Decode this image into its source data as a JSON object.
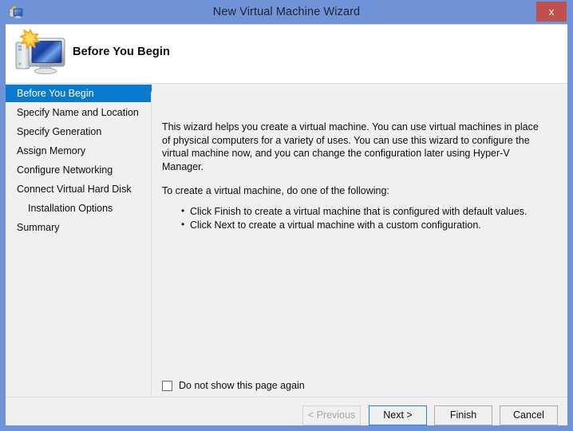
{
  "window": {
    "title": "New Virtual Machine Wizard",
    "title_icon": "virtual-machine-icon",
    "close_label": "x",
    "frame_color": "#6f93d6",
    "close_color": "#c0504d"
  },
  "banner": {
    "heading": "Before You Begin",
    "icon": "monitor-with-star-icon"
  },
  "sidebar": {
    "items": [
      {
        "label": "Before You Begin",
        "selected": true,
        "indent": false
      },
      {
        "label": "Specify Name and Location",
        "selected": false,
        "indent": false
      },
      {
        "label": "Specify Generation",
        "selected": false,
        "indent": false
      },
      {
        "label": "Assign Memory",
        "selected": false,
        "indent": false
      },
      {
        "label": "Configure Networking",
        "selected": false,
        "indent": false
      },
      {
        "label": "Connect Virtual Hard Disk",
        "selected": false,
        "indent": false
      },
      {
        "label": "Installation Options",
        "selected": false,
        "indent": true
      },
      {
        "label": "Summary",
        "selected": false,
        "indent": false
      }
    ],
    "selected_color": "#0a7ad1"
  },
  "content": {
    "paragraph1": "This wizard helps you create a virtual machine. You can use virtual machines in place of physical computers for a variety of uses. You can use this wizard to configure the virtual machine now, and you can change the configuration later using Hyper-V Manager.",
    "paragraph2": "To create a virtual machine, do one of the following:",
    "bullets": [
      "Click Finish to create a virtual machine that is configured with default values.",
      "Click Next to create a virtual machine with a custom configuration."
    ]
  },
  "checkbox": {
    "label": "Do not show this page again",
    "checked": false
  },
  "footer": {
    "buttons": [
      {
        "label": "< Previous",
        "state": "disabled"
      },
      {
        "label": "Next >",
        "state": "focused"
      },
      {
        "label": "Finish",
        "state": "normal"
      },
      {
        "label": "Cancel",
        "state": "normal"
      }
    ]
  }
}
